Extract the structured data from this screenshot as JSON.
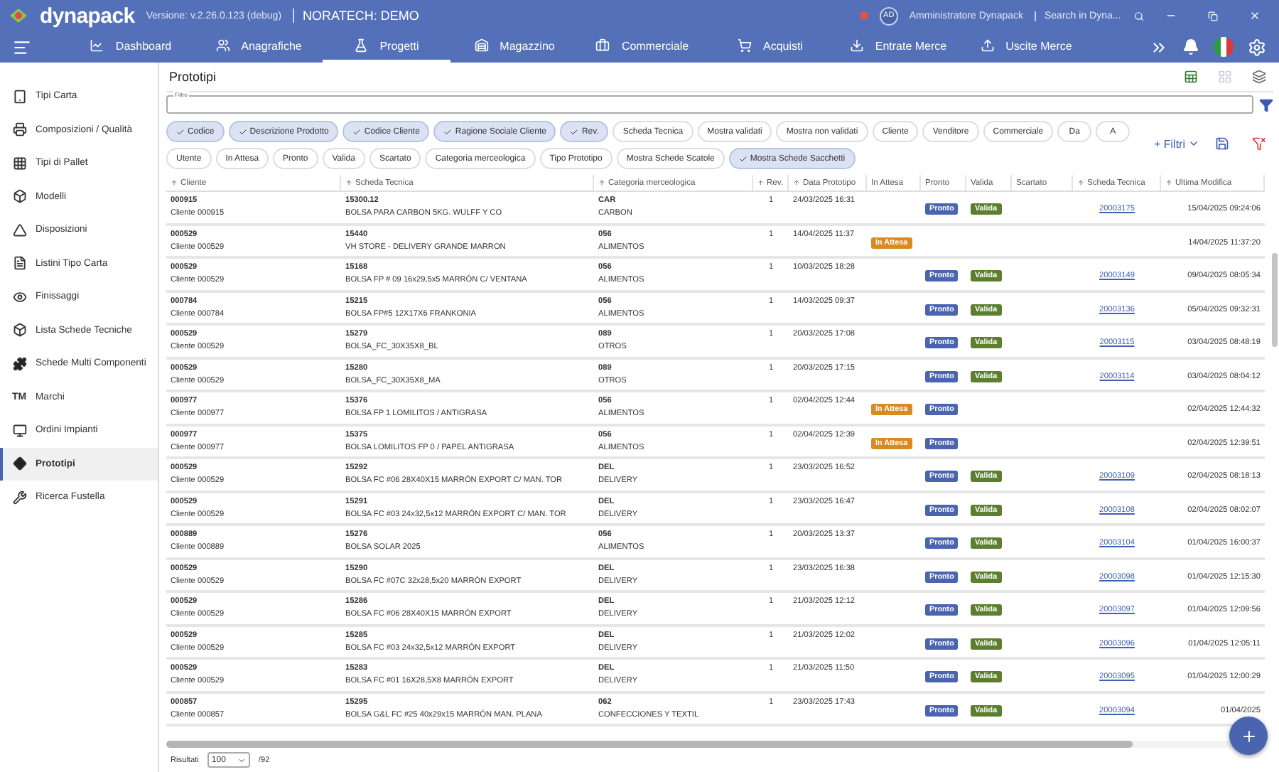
{
  "app": {
    "logo": "dynapack",
    "version": "Versione: v.2.26.0.123 (debug)",
    "company": "NORATECH: DEMO",
    "user": {
      "initials": "AD",
      "name": "Amministratore Dynapack"
    },
    "search": {
      "placeholder": "Search in Dyna..."
    }
  },
  "nav": [
    {
      "label": "Dashboard",
      "selected": false
    },
    {
      "label": "Anagrafiche",
      "selected": false
    },
    {
      "label": "Progetti",
      "selected": true
    },
    {
      "label": "Magazzino",
      "selected": false
    },
    {
      "label": "Commerciale",
      "selected": false
    },
    {
      "label": "Acquisti",
      "selected": false
    },
    {
      "label": "Entrate Merce",
      "selected": false
    },
    {
      "label": "Uscite Merce",
      "selected": false
    }
  ],
  "sidebar": {
    "items": [
      {
        "label": "Tipi Carta",
        "selected": false
      },
      {
        "label": "Composizioni / Qualità",
        "selected": false
      },
      {
        "label": "Tipi di Pallet",
        "selected": false
      },
      {
        "label": "Modelli",
        "selected": false
      },
      {
        "label": "Disposizioni",
        "selected": false
      },
      {
        "label": "Listini Tipo Carta",
        "selected": false
      },
      {
        "label": "Finissaggi",
        "selected": false
      },
      {
        "label": "Lista Schede Tecniche",
        "selected": false
      },
      {
        "label": "Schede Multi Componenti",
        "selected": false
      },
      {
        "label": "Marchi",
        "symbol": "TM",
        "selected": false
      },
      {
        "label": "Ordini Impianti",
        "selected": false
      },
      {
        "label": "Prototipi",
        "selected": true
      },
      {
        "label": "Ricerca Fustella",
        "selected": false
      }
    ]
  },
  "page": {
    "title": "Prototipi",
    "filter": {
      "label": "Filtro"
    },
    "chips": [
      {
        "label": "Codice",
        "checked": true
      },
      {
        "label": "Descrizione Prodotto",
        "checked": true
      },
      {
        "label": "Codice Cliente",
        "checked": true
      },
      {
        "label": "Ragione Sociale Cliente",
        "checked": true
      },
      {
        "label": "Rev.",
        "checked": true
      },
      {
        "label": "Scheda Tecnica",
        "checked": false
      },
      {
        "label": "Mostra validati",
        "checked": false
      },
      {
        "label": "Mostra non validati",
        "checked": false
      },
      {
        "label": "Cliente",
        "checked": false
      },
      {
        "label": "Venditore",
        "checked": false
      },
      {
        "label": "Commerciale",
        "checked": false
      },
      {
        "label": "Da",
        "checked": false
      },
      {
        "label": "A",
        "checked": false
      },
      {
        "label": "Utente",
        "checked": false
      },
      {
        "label": "In Attesa",
        "checked": false
      },
      {
        "label": "Pronto",
        "checked": false
      },
      {
        "label": "Valida",
        "checked": false
      },
      {
        "label": "Scartato",
        "checked": false
      },
      {
        "label": "Categoria merceologica",
        "checked": false
      },
      {
        "label": "Tipo Prototipo",
        "checked": false
      },
      {
        "label": "Mostra Schede Scatole",
        "checked": false
      },
      {
        "label": "Mostra Schede Sacchetti",
        "checked": true
      }
    ],
    "more_filters": "+ Filtri"
  },
  "table": {
    "columns": [
      {
        "label": "Cliente",
        "sortable": true
      },
      {
        "label": "Scheda Tecnica",
        "sortable": true
      },
      {
        "label": "Categoria merceologica",
        "sortable": true
      },
      {
        "label": "Rev.",
        "sortable": true
      },
      {
        "label": "Data Prototipo",
        "sortable": true
      },
      {
        "label": "In Attesa",
        "sortable": false
      },
      {
        "label": "Pronto",
        "sortable": false
      },
      {
        "label": "Valida",
        "sortable": false
      },
      {
        "label": "Scartato",
        "sortable": false
      },
      {
        "label": "Scheda Tecnica",
        "sortable": true
      },
      {
        "label": "Ultima Modifica",
        "sortable": true
      }
    ],
    "rows": [
      {
        "client": "000915",
        "client_name": "Cliente 000915",
        "code": "15300.12",
        "description": "BOLSA PARA CARBON 5KG. WULFF Y CO",
        "cat": "CAR",
        "cat_name": "CARBON",
        "rev": "1",
        "date": "24/03/2025 16:31",
        "badges": [
          {
            "kind": "pronto",
            "label": "Pronto"
          },
          {
            "kind": "valida",
            "label": "Valida"
          }
        ],
        "sheet": "20003175",
        "modified": "15/04/2025 09:24:06"
      },
      {
        "client": "000529",
        "client_name": "Cliente 000529",
        "code": "15440",
        "description": "VH STORE - DELIVERY GRANDE MARRON",
        "cat": "056",
        "cat_name": "ALIMENTOS",
        "rev": "1",
        "date": "14/04/2025 11:37",
        "badges": [
          {
            "kind": "attesa",
            "label": "In Attesa"
          }
        ],
        "modified": "14/04/2025 11:37:20"
      },
      {
        "client": "000529",
        "client_name": "Cliente 000529",
        "code": "15168",
        "description": "BOLSA FP # 09 16x29,5x5 MARRÓN C/ VENTANA",
        "cat": "056",
        "cat_name": "ALIMENTOS",
        "rev": "1",
        "date": "10/03/2025 18:28",
        "badges": [
          {
            "kind": "pronto",
            "label": "Pronto"
          },
          {
            "kind": "valida",
            "label": "Valida"
          }
        ],
        "sheet": "20003149",
        "modified": "09/04/2025 08:05:34"
      },
      {
        "client": "000784",
        "client_name": "Cliente 000784",
        "code": "15215",
        "description": "BOLSA FP#5 12X17X6 FRANKONIA",
        "cat": "056",
        "cat_name": "ALIMENTOS",
        "rev": "1",
        "date": "14/03/2025 09:37",
        "badges": [
          {
            "kind": "pronto",
            "label": "Pronto"
          },
          {
            "kind": "valida",
            "label": "Valida"
          }
        ],
        "sheet": "20003136",
        "modified": "05/04/2025 09:32:31"
      },
      {
        "client": "000529",
        "client_name": "Cliente 000529",
        "code": "15279",
        "description": "BOLSA_FC_30X35X8_BL",
        "cat": "089",
        "cat_name": "OTROS",
        "rev": "1",
        "date": "20/03/2025 17:08",
        "badges": [
          {
            "kind": "pronto",
            "label": "Pronto"
          },
          {
            "kind": "valida",
            "label": "Valida"
          }
        ],
        "sheet": "20003115",
        "modified": "03/04/2025 08:48:19"
      },
      {
        "client": "000529",
        "client_name": "Cliente 000529",
        "code": "15280",
        "description": "BOLSA_FC_30X35X8_MA",
        "cat": "089",
        "cat_name": "OTROS",
        "rev": "1",
        "date": "20/03/2025 17:15",
        "badges": [
          {
            "kind": "pronto",
            "label": "Pronto"
          },
          {
            "kind": "valida",
            "label": "Valida"
          }
        ],
        "sheet": "20003114",
        "modified": "03/04/2025 08:04:12"
      },
      {
        "client": "000977",
        "client_name": "Cliente 000977",
        "code": "15376",
        "description": "BOLSA FP 1 LOMILITOS / ANTIGRASA",
        "cat": "056",
        "cat_name": "ALIMENTOS",
        "rev": "1",
        "date": "02/04/2025 12:44",
        "badges": [
          {
            "kind": "attesa",
            "label": "In Attesa"
          },
          {
            "kind": "pronto",
            "label": "Pronto"
          }
        ],
        "modified": "02/04/2025 12:44:32"
      },
      {
        "client": "000977",
        "client_name": "Cliente 000977",
        "code": "15375",
        "description": "BOLSA LOMILITOS FP 0 / PAPEL ANTIGRASA",
        "cat": "056",
        "cat_name": "ALIMENTOS",
        "rev": "1",
        "date": "02/04/2025 12:39",
        "badges": [
          {
            "kind": "attesa",
            "label": "In Attesa"
          },
          {
            "kind": "pronto",
            "label": "Pronto"
          }
        ],
        "modified": "02/04/2025 12:39:51"
      },
      {
        "client": "000529",
        "client_name": "Cliente 000529",
        "code": "15292",
        "description": "BOLSA FC #06 28X40X15 MARRÓN EXPORT C/ MAN. TOR",
        "cat": "DEL",
        "cat_name": "DELIVERY",
        "rev": "1",
        "date": "23/03/2025 16:52",
        "badges": [
          {
            "kind": "pronto",
            "label": "Pronto"
          },
          {
            "kind": "valida",
            "label": "Valida"
          }
        ],
        "sheet": "20003109",
        "modified": "02/04/2025 08:18:13"
      },
      {
        "client": "000529",
        "client_name": "Cliente 000529",
        "code": "15291",
        "description": "BOLSA FC #03 24x32,5x12 MARRÓN EXPORT C/ MAN. TOR",
        "cat": "DEL",
        "cat_name": "DELIVERY",
        "rev": "1",
        "date": "23/03/2025 16:47",
        "badges": [
          {
            "kind": "pronto",
            "label": "Pronto"
          },
          {
            "kind": "valida",
            "label": "Valida"
          }
        ],
        "sheet": "20003108",
        "modified": "02/04/2025 08:02:07"
      },
      {
        "client": "000889",
        "client_name": "Cliente 000889",
        "code": "15276",
        "description": "BOLSA SOLAR 2025",
        "cat": "056",
        "cat_name": "ALIMENTOS",
        "rev": "1",
        "date": "20/03/2025 13:37",
        "badges": [
          {
            "kind": "pronto",
            "label": "Pronto"
          },
          {
            "kind": "valida",
            "label": "Valida"
          }
        ],
        "sheet": "20003104",
        "modified": "01/04/2025 16:00:37"
      },
      {
        "client": "000529",
        "client_name": "Cliente 000529",
        "code": "15290",
        "description": "BOLSA FC #07C 32x28,5x20 MARRÓN EXPORT",
        "cat": "DEL",
        "cat_name": "DELIVERY",
        "rev": "1",
        "date": "23/03/2025 16:38",
        "badges": [
          {
            "kind": "pronto",
            "label": "Pronto"
          },
          {
            "kind": "valida",
            "label": "Valida"
          }
        ],
        "sheet": "20003098",
        "modified": "01/04/2025 12:15:30"
      },
      {
        "client": "000529",
        "client_name": "Cliente 000529",
        "code": "15286",
        "description": "BOLSA FC #06 28X40X15 MARRÓN EXPORT",
        "cat": "DEL",
        "cat_name": "DELIVERY",
        "rev": "1",
        "date": "21/03/2025 12:12",
        "badges": [
          {
            "kind": "pronto",
            "label": "Pronto"
          },
          {
            "kind": "valida",
            "label": "Valida"
          }
        ],
        "sheet": "20003097",
        "modified": "01/04/2025 12:09:56"
      },
      {
        "client": "000529",
        "client_name": "Cliente 000529",
        "code": "15285",
        "description": "BOLSA FC #03 24x32,5x12 MARRÓN EXPORT",
        "cat": "DEL",
        "cat_name": "DELIVERY",
        "rev": "1",
        "date": "21/03/2025 12:02",
        "badges": [
          {
            "kind": "pronto",
            "label": "Pronto"
          },
          {
            "kind": "valida",
            "label": "Valida"
          }
        ],
        "sheet": "20003096",
        "modified": "01/04/2025 12:05:11"
      },
      {
        "client": "000529",
        "client_name": "Cliente 000529",
        "code": "15283",
        "description": "BOLSA FC #01 16X28,5X8 MARRÓN EXPORT",
        "cat": "DEL",
        "cat_name": "DELIVERY",
        "rev": "1",
        "date": "21/03/2025 11:50",
        "badges": [
          {
            "kind": "pronto",
            "label": "Pronto"
          },
          {
            "kind": "valida",
            "label": "Valida"
          }
        ],
        "sheet": "20003095",
        "modified": "01/04/2025 12:00:29"
      },
      {
        "client": "000857",
        "client_name": "Cliente 000857",
        "code": "15295",
        "description": "BOLSA G&L FC #25 40x29x15 MARRÓN MAN. PLANA",
        "cat": "062",
        "cat_name": "CONFECCIONES Y TEXTIL",
        "rev": "1",
        "date": "23/03/2025 17:43",
        "badges": [
          {
            "kind": "pronto",
            "label": "Pronto"
          },
          {
            "kind": "valida",
            "label": "Valida"
          }
        ],
        "sheet": "20003094",
        "modified": "01/04/2025"
      }
    ]
  },
  "footer": {
    "label": "Risultati",
    "page_size": "100",
    "total": "/92"
  }
}
